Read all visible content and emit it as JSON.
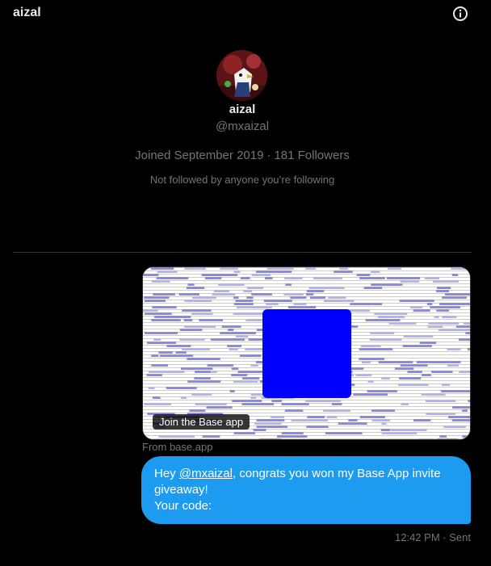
{
  "header": {
    "title": "aizal",
    "info_icon": "info-icon"
  },
  "profile": {
    "name": "aizal",
    "handle": "@mxaizal",
    "joined": "Joined September 2019",
    "separator": "·",
    "followers": "181 Followers",
    "note": "Not followed by anyone you’re following"
  },
  "card": {
    "label": "Join the Base app",
    "source": "From base.app",
    "accent": "#0000ff"
  },
  "message": {
    "prefix": "Hey ",
    "mention": "@mxaizal",
    "line1_rest": ", congrats you won my Base App invite",
    "line2": "giveaway!",
    "line3": "Your code:",
    "time": "12:42 PM",
    "separator": "·",
    "status": "Sent"
  },
  "colors": {
    "background": "#000000",
    "bubble": "#1d9bf0",
    "secondary_text": "#71767b",
    "primary_text": "#e7e9ea"
  }
}
